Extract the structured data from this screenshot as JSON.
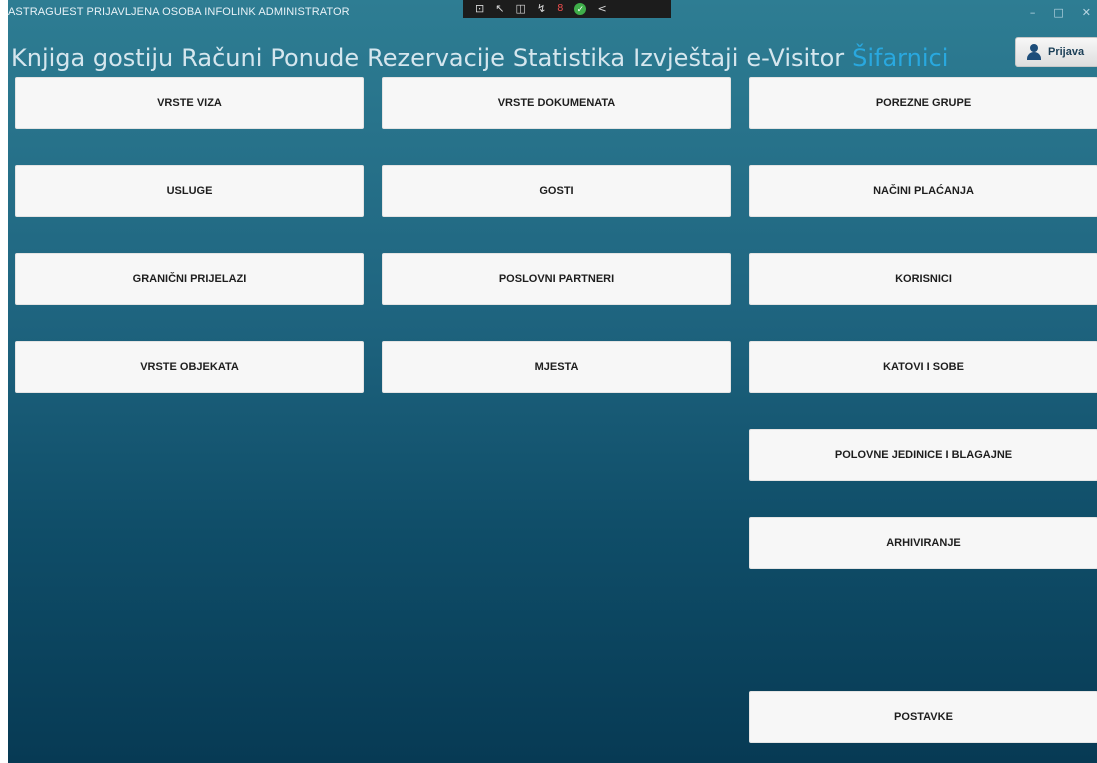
{
  "window": {
    "title": "ASTRAGUEST PRIJAVLJENA OSOBA INFOLINK ADMINISTRATOR",
    "controls": {
      "minimize": "–",
      "maximize": "□",
      "close": "✕"
    }
  },
  "tray": {
    "count": "8",
    "back": "<"
  },
  "menu": {
    "items": [
      "Knjiga gostiju",
      "Računi",
      "Ponude",
      "Rezervacije",
      "Statistika",
      "Izvještaji",
      "e-Visitor",
      "Šifarnici"
    ],
    "active": "Šifarnici"
  },
  "login_button": {
    "label": "Prijava",
    "icon": "user-icon"
  },
  "tiles": {
    "col1": [
      "VRSTE VIZA",
      "USLUGE",
      "GRANIČNI PRIJELAZI",
      "VRSTE OBJEKATA"
    ],
    "col2": [
      "VRSTE DOKUMENATA",
      "GOSTI",
      "POSLOVNI PARTNERI",
      "MJESTA"
    ],
    "col3": [
      "POREZNE GRUPE",
      "NAČINI PLAĆANJA",
      "KORISNICI",
      "KATOVI I SOBE",
      "POLOVNE JEDINICE I BLAGAJNE",
      "ARHIVIRANJE",
      "POSTAVKE"
    ]
  },
  "colors": {
    "menu_text": "#d5e6ee",
    "menu_active": "#29a8df",
    "tile_bg": "#f7f7f7"
  }
}
